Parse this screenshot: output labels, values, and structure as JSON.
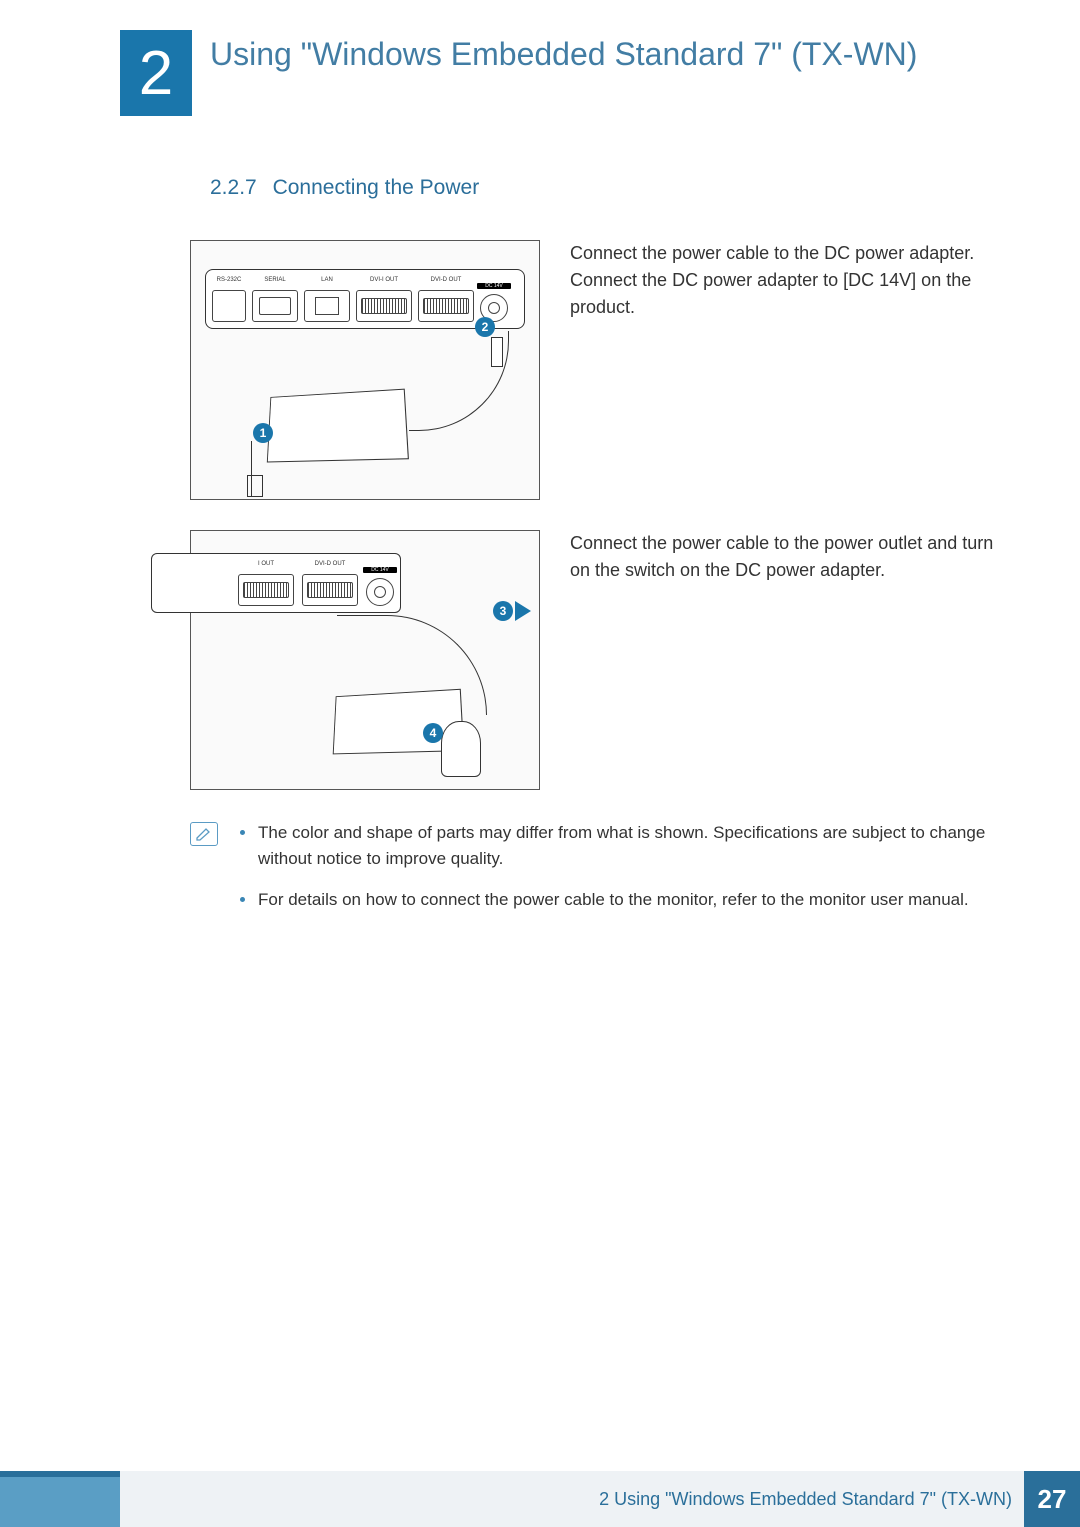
{
  "chapter": {
    "number": "2",
    "title": "Using \"Windows Embedded Standard 7\" (TX-WN)"
  },
  "section": {
    "number": "2.2.7",
    "title": "Connecting the Power"
  },
  "step1": {
    "text": "Connect the power cable to the DC power adapter. Connect the DC power adapter to [DC 14V] on the product.",
    "ports": {
      "rs232": "RS-232C",
      "serial": "SERIAL",
      "lan": "LAN",
      "dviI": "DVI-I OUT",
      "dviD": "DVI-D OUT",
      "dc": "DC 14V"
    },
    "badge1": "1",
    "badge2": "2"
  },
  "step2": {
    "text": "Connect the power cable to the power outlet and turn on the switch on the DC power adapter.",
    "ports": {
      "dviI": "I OUT",
      "dviD": "DVI-D OUT",
      "dc": "DC 14V"
    },
    "badge3": "3",
    "badge4": "4"
  },
  "notes": {
    "item1": "The color and shape of parts may differ from what is shown. Specifications are subject to change without notice to improve quality.",
    "item2": "For details on how to connect the power cable to the monitor, refer to the monitor user manual."
  },
  "footer": {
    "text": "2 Using \"Windows Embedded Standard 7\" (TX-WN)",
    "page": "27"
  }
}
